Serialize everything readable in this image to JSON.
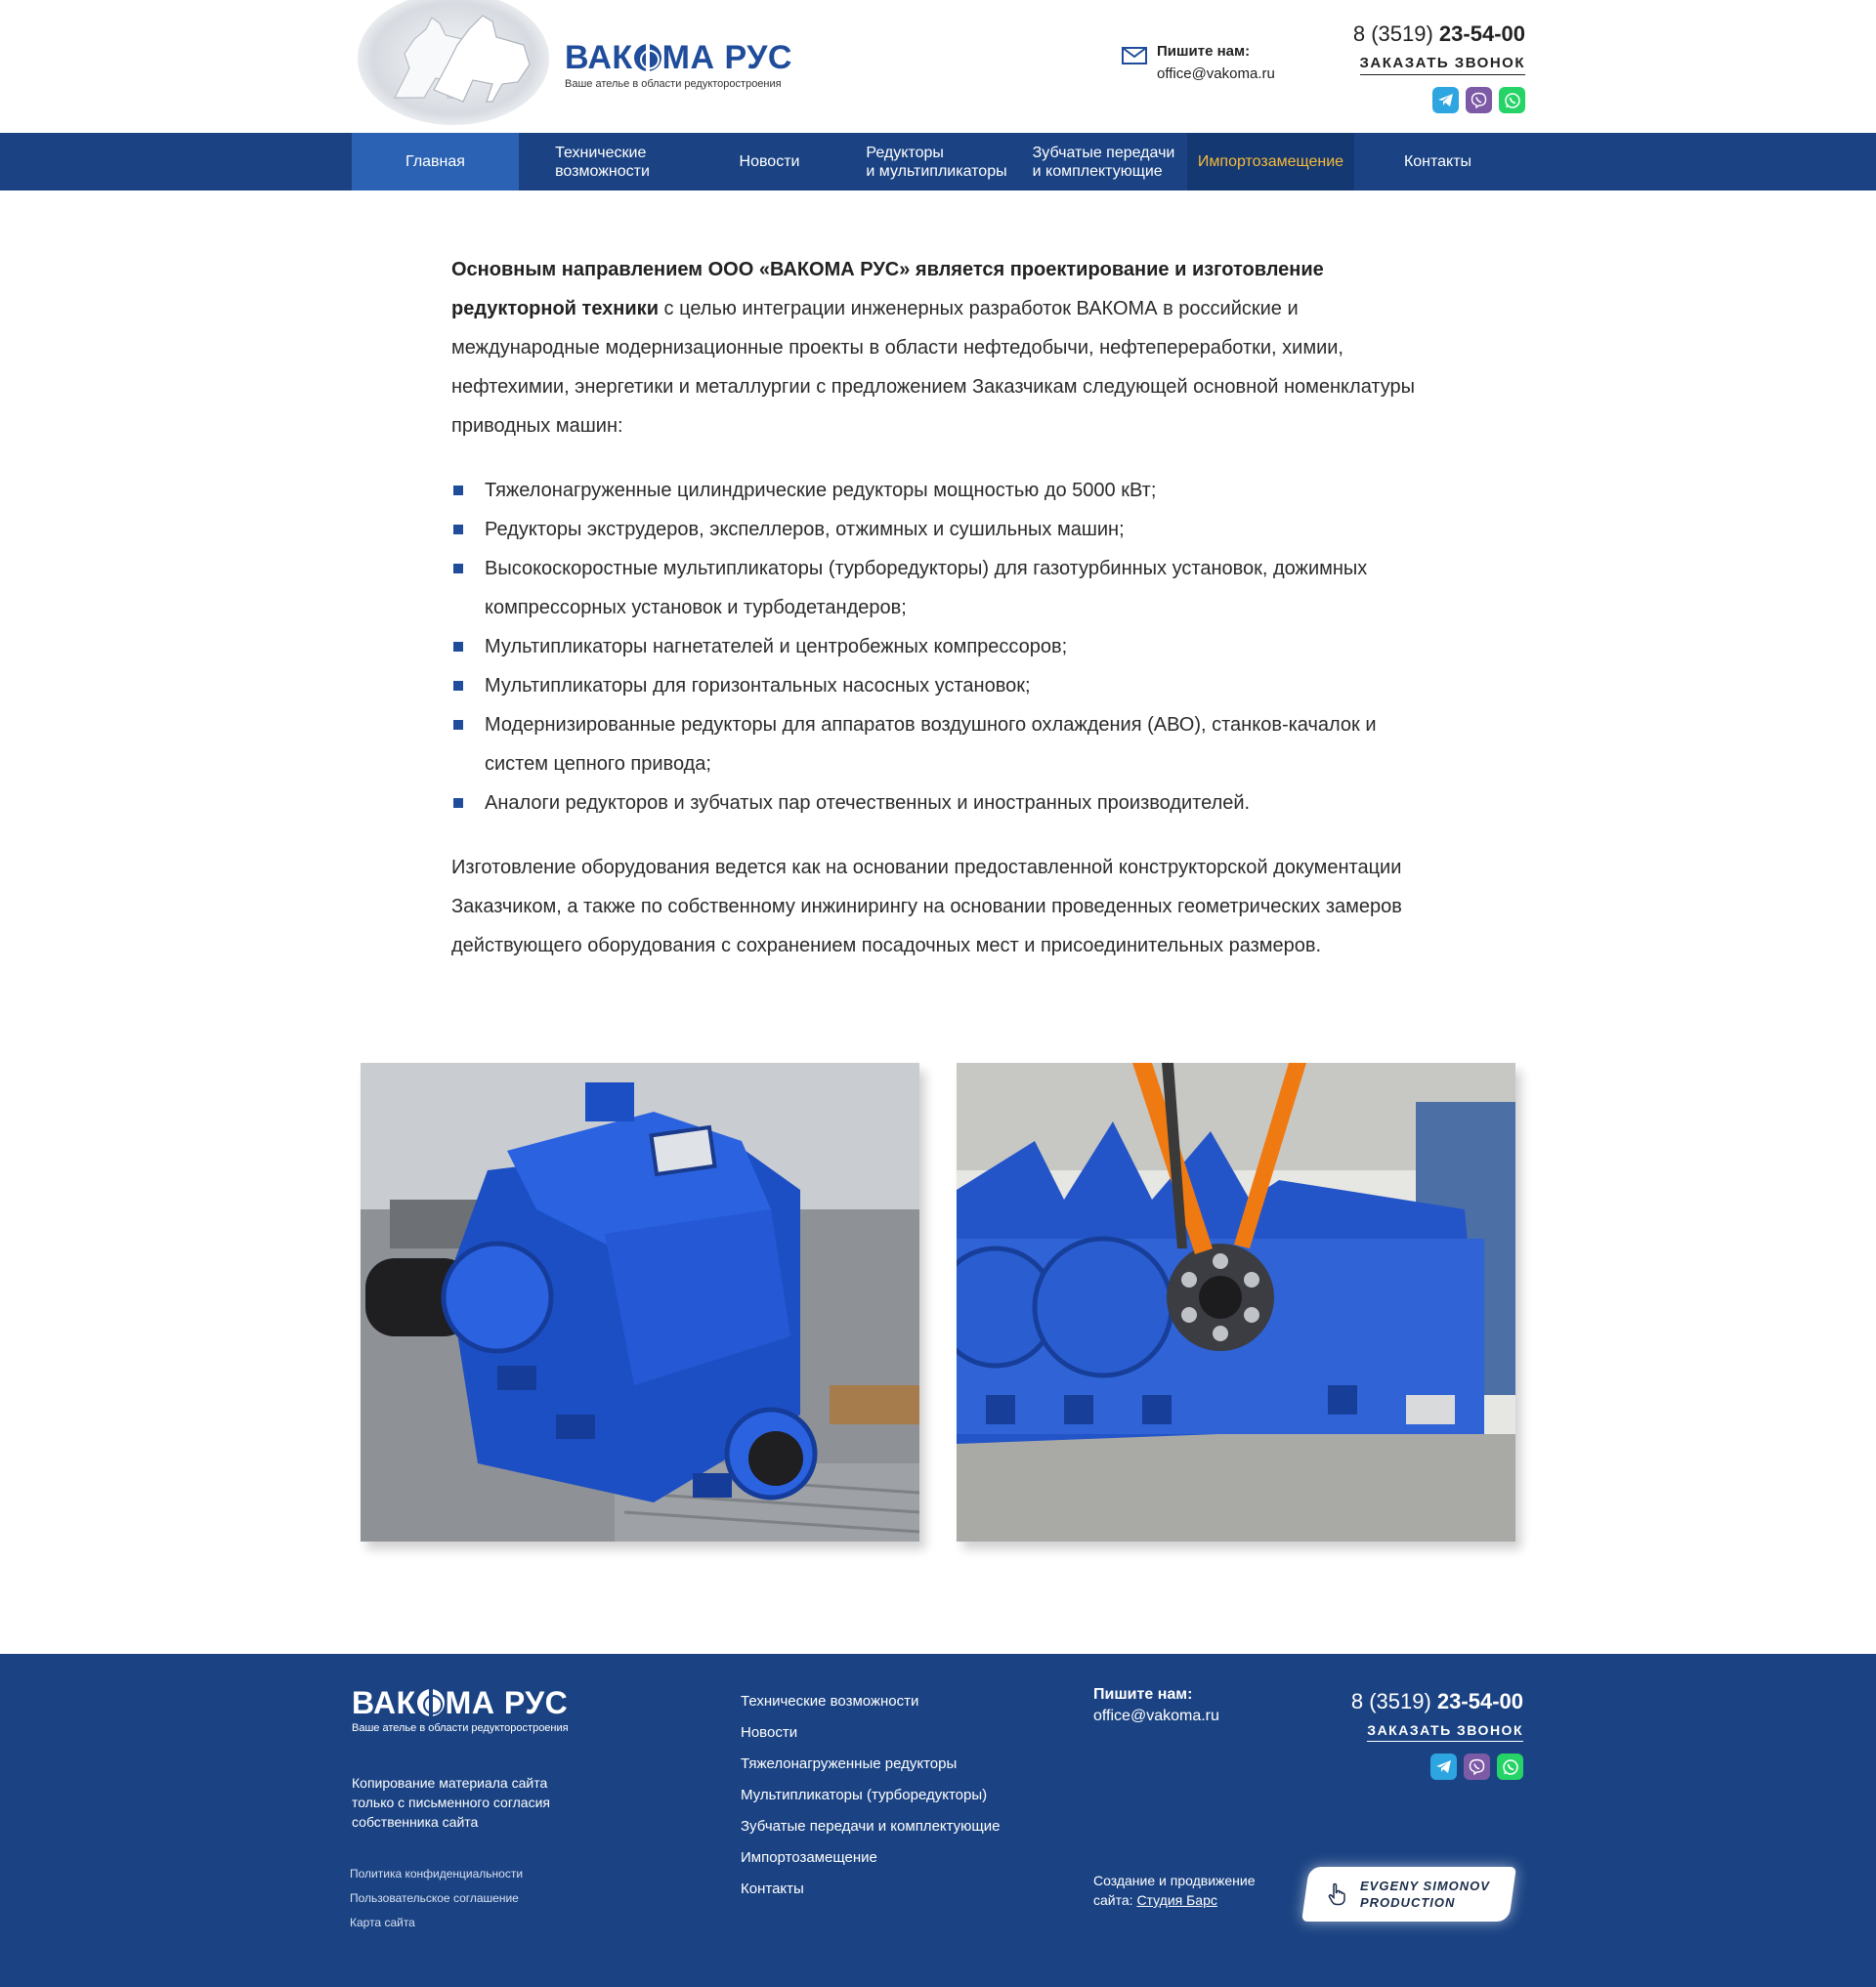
{
  "header": {
    "logo_text_left": "ВАК",
    "logo_text_right": "МА РУС",
    "logo_subtitle": "Ваше ателье в области редукторостроения",
    "write_title": "Пишите нам:",
    "write_email": "office@vakoma.ru",
    "phone_prefix": "8 (3519)",
    "phone_number": "23-54-00",
    "callback_label": "ЗАКАЗАТЬ ЗВОНОК",
    "socials": [
      "telegram-icon",
      "viber-icon",
      "whatsapp-icon"
    ]
  },
  "nav": {
    "items": [
      {
        "line1": "Главная",
        "line2": ""
      },
      {
        "line1": "Технические",
        "line2": "возможности"
      },
      {
        "line1": "Новости",
        "line2": ""
      },
      {
        "line1": "Редукторы",
        "line2": "и мультипликаторы"
      },
      {
        "line1": "Зубчатые передачи",
        "line2": "и комплектующие"
      },
      {
        "line1": "Импортозамещение",
        "line2": ""
      },
      {
        "line1": "Контакты",
        "line2": ""
      }
    ],
    "active_index": 0
  },
  "content": {
    "intro_bold_1": "Основным направлением ООО «ВАКОМА РУС» является проектирование и изготовление редукторной техники",
    "intro_rest": " с целью интеграции инженерных разработок ВАКОМА в российские и международные модернизационные проекты в области нефтедобычи, нефтепереработки, химии, нефтехимии, энергетики и металлургии с предложением Заказчикам следующей основной номенклатуры приводных машин:",
    "list": [
      "Тяжелонагруженные цилиндрические редукторы мощностью до 5000 кВт;",
      "Редукторы экструдеров, экспеллеров, отжимных и сушильных машин;",
      "Высокоскоростные мультипликаторы (турборедукторы) для газотурбинных установок, дожимных компрессорных установок и турбодетандеров;",
      "Мультипликаторы нагнетателей и центробежных компрессоров;",
      "Мультипликаторы для горизонтальных насосных установок;",
      "Модернизированные редукторы для аппаратов воздушного охлаждения (АВО), станков-качалок и систем цепного привода;",
      "Аналоги редукторов и зубчатых пар отечественных и иностранных производителей."
    ],
    "outro": "Изготовление оборудования ведется как на основании предоставленной конструкторской документации Заказчиком, а также по собственному инжинирингу на основании проведенных геометрических замеров действующего оборудования с сохранением посадочных мест и присоединительных размеров."
  },
  "footer": {
    "copy_text": "Копирование материала сайта только с письменного согласия собственника сайта",
    "legal_links": [
      "Политика конфиденциальности",
      "Пользовательское соглашение",
      "Карта сайта"
    ],
    "menu": [
      "Технические возможности",
      "Новости",
      "Тяжелонагруженные редукторы",
      "Мультипликаторы (турборедукторы)",
      "Зубчатые передачи и комплектующие",
      "Импортозамещение",
      "Контакты"
    ],
    "write_title": "Пишите нам:",
    "write_email": "office@vakoma.ru",
    "phone_prefix": "8 (3519)",
    "phone_number": "23-54-00",
    "callback_label": "ЗАКАЗАТЬ ЗВОНОК",
    "dev_text_1": "Создание и продвижение",
    "dev_text_2": "сайта:",
    "dev_link": "Студия Барс",
    "badge_line1": "EVGENY SIMONOV",
    "badge_line2": "PRODUCTION"
  },
  "colors": {
    "brand_blue": "#1b4383",
    "logo_blue": "#1f4d9b",
    "nav_active": "#2b62b3",
    "import_accent": "#f6b93b"
  }
}
